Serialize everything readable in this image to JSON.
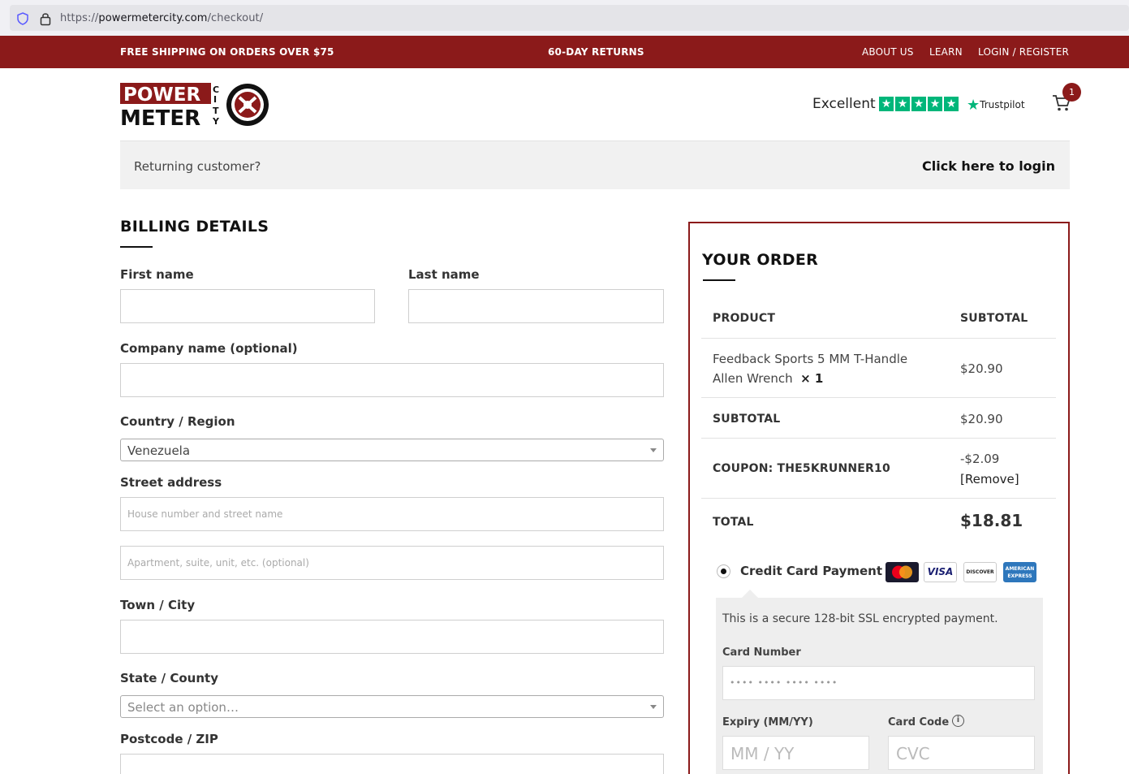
{
  "browser": {
    "url_prefix": "https://",
    "url_domain": "powermetercity.com",
    "url_path": "/checkout/"
  },
  "topbar": {
    "shipping": "FREE SHIPPING ON ORDERS OVER $75",
    "returns": "60-DAY RETURNS",
    "nav": [
      "ABOUT US",
      "LEARN",
      "LOGIN / REGISTER"
    ]
  },
  "header": {
    "logo_text_line1": "POWER",
    "logo_text_line2": "METER",
    "logo_text_city": "CITY",
    "trust_rating": "Excellent",
    "trust_brand": "Trustpilot",
    "cart_count": "1"
  },
  "returning": {
    "question": "Returning customer?",
    "login_link": "Click here to login"
  },
  "billing": {
    "title": "BILLING DETAILS",
    "first_name_label": "First name",
    "last_name_label": "Last name",
    "company_label": "Company name (optional)",
    "country_label": "Country / Region",
    "country_value": "Venezuela",
    "street_label": "Street address",
    "street1_placeholder": "House number and street name",
    "street2_placeholder": "Apartment, suite, unit, etc. (optional)",
    "city_label": "Town / City",
    "state_label": "State / County",
    "state_placeholder": "Select an option…",
    "postcode_label": "Postcode / ZIP"
  },
  "order": {
    "title": "YOUR ORDER",
    "col_product": "PRODUCT",
    "col_subtotal": "SUBTOTAL",
    "item_name_line1": "Feedback Sports 5 MM T-Handle",
    "item_name_line2": "Allen Wrench",
    "item_qty": "× 1",
    "item_price": "$20.90",
    "subtotal_label": "SUBTOTAL",
    "subtotal_value": "$20.90",
    "coupon_label": "COUPON: THE5KRUNNER10",
    "coupon_value": "-$2.09",
    "coupon_remove": "[Remove]",
    "total_label": "TOTAL",
    "total_value": "$18.81"
  },
  "payment": {
    "method_label": "Credit Card Payment",
    "cards": [
      "MasterCard",
      "VISA",
      "DISCOVER",
      "AMERICAN EXPRESS"
    ],
    "secure_text": "This is a secure 128-bit SSL encrypted payment.",
    "card_number_label": "Card Number",
    "card_number_placeholder": "•••• •••• •••• ••••",
    "expiry_label": "Expiry (MM/YY)",
    "expiry_placeholder": "MM / YY",
    "card_code_label": "Card Code",
    "card_code_placeholder": "CVC"
  }
}
